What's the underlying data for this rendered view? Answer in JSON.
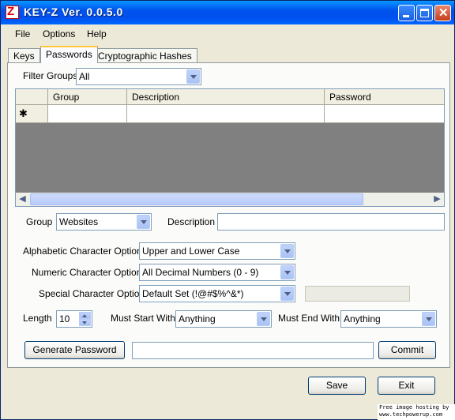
{
  "window": {
    "title": "KEY-Z   Ver. 0.0.5.0"
  },
  "menu": [
    "File",
    "Options",
    "Help"
  ],
  "tabs": [
    "Keys",
    "Passwords",
    "Cryptographic Hashes"
  ],
  "filter": {
    "label": "Filter Groups",
    "value": "All"
  },
  "grid": {
    "columns": [
      "Group",
      "Description",
      "Password"
    ],
    "new_row_marker": "✱"
  },
  "group": {
    "label": "Group",
    "value": "Websites"
  },
  "description": {
    "label": "Description",
    "value": ""
  },
  "alpha": {
    "label": "Alphabetic Character Options",
    "value": "Upper and Lower Case"
  },
  "numeric": {
    "label": "Numeric Character Options",
    "value": "All Decimal Numbers (0 - 9)"
  },
  "special": {
    "label": "Special Character Option",
    "value": "Default Set (!@#$%^&*)"
  },
  "length": {
    "label": "Length",
    "value": "10"
  },
  "start": {
    "label": "Must Start With",
    "value": "Anything"
  },
  "end": {
    "label": "Must End With",
    "value": "Anything"
  },
  "buttons": {
    "generate": "Generate Password",
    "commit": "Commit",
    "save": "Save",
    "exit": "Exit"
  },
  "watermark": [
    "Free image hosting by",
    "www.techpowerup.com"
  ]
}
